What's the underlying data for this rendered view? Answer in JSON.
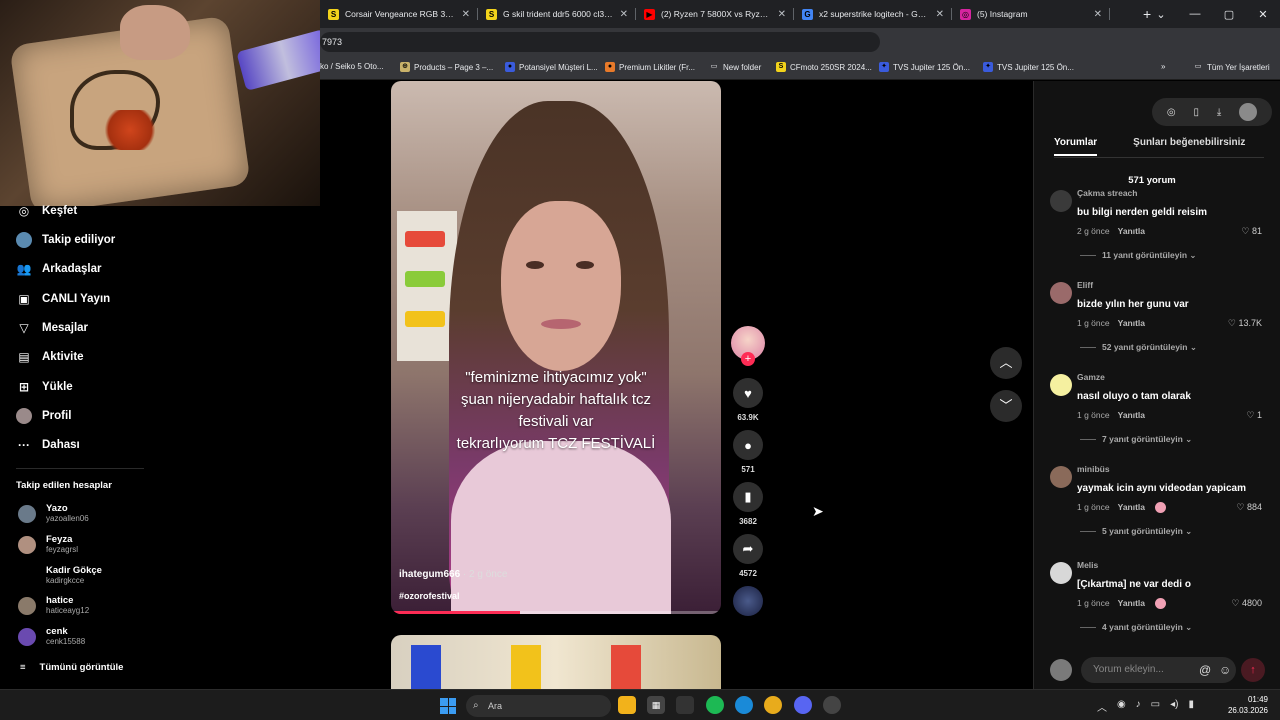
{
  "browser": {
    "tabs": [
      {
        "title": "Corsair Vengeance RGB 32 GB",
        "color": "#f2d31b",
        "letter": "S"
      },
      {
        "title": "G skil trident ddr5 6000 cl30 s",
        "color": "#f2d31b",
        "letter": "S"
      },
      {
        "title": "(2) Ryzen 7 5800X vs Ryzen 7 5",
        "color": "#ff0000",
        "letter": "▶"
      },
      {
        "title": "x2 superstrike logitech - Googl",
        "color": "#4285f4",
        "letter": "G"
      },
      {
        "title": "(5) Instagram",
        "color": "#d6249f",
        "letter": "◎"
      }
    ],
    "url_fragment": "7973",
    "bookmarks": [
      {
        "label": "ko / Seiko 5 Oto...",
        "color": "#000000",
        "letter": ""
      },
      {
        "label": "Products – Page 3 –...",
        "color": "#c9b26a",
        "letter": "⊕"
      },
      {
        "label": "Potansiyel Müşteri L...",
        "color": "#3a5bdc",
        "letter": "●"
      },
      {
        "label": "Premium Likitler (Fr...",
        "color": "#e87a2a",
        "letter": "●"
      },
      {
        "label": "New folder",
        "color": "#35363a",
        "letter": "▭"
      },
      {
        "label": "CFmoto 250SR 2024...",
        "color": "#f2d31b",
        "letter": "S"
      },
      {
        "label": "TVS Jupiter 125 Ön...",
        "color": "#3a5bdc",
        "letter": "✦"
      },
      {
        "label": "TVS Jupiter 125 Ön...",
        "color": "#3a5bdc",
        "letter": "✦"
      },
      {
        "label": "Tüm Yer İşaretleri",
        "color": "#35363a",
        "letter": "▭"
      }
    ]
  },
  "sidebar": {
    "nav": [
      {
        "label": "Keşfet",
        "icon": "compass-icon",
        "glyph": "◎"
      },
      {
        "label": "Takip ediliyor",
        "icon": "following-avatar-icon",
        "glyph": ""
      },
      {
        "label": "Arkadaşlar",
        "icon": "friends-icon",
        "glyph": "👥"
      },
      {
        "label": "CANLI Yayın",
        "icon": "live-icon",
        "glyph": "▣"
      },
      {
        "label": "Mesajlar",
        "icon": "messages-icon",
        "glyph": "▽"
      },
      {
        "label": "Aktivite",
        "icon": "activity-icon",
        "glyph": "▤"
      },
      {
        "label": "Yükle",
        "icon": "upload-icon",
        "glyph": "⊞"
      },
      {
        "label": "Profil",
        "icon": "profile-avatar-icon",
        "glyph": ""
      },
      {
        "label": "Dahası",
        "icon": "more-dots-icon",
        "glyph": "···"
      }
    ],
    "following_title": "Takip edilen hesaplar",
    "following": [
      {
        "name": "Yazo",
        "user": "yazoallen06"
      },
      {
        "name": "Feyza",
        "user": "feyzagrsl"
      },
      {
        "name": "Kadir Gökçe",
        "user": "kadirgkcce"
      },
      {
        "name": "hatice",
        "user": "haticeayg12"
      },
      {
        "name": "cenk",
        "user": "cenk15588"
      }
    ],
    "see_all": "Tümünü görüntüle"
  },
  "video": {
    "caption_lines": [
      "\"feminizme ihtiyacımız yok\"",
      "şuan nijeryadabir haftalık tcz",
      "festivali var",
      "tekrarlıyorum TCZ FESTİVALİ"
    ],
    "username": "ihategum666",
    "date": " · 2 g önce",
    "hashtag": "#ozorofestival",
    "progress": 0.39
  },
  "actions": {
    "likes": "63.9K",
    "comments": "571",
    "saves": "3682",
    "shares": "4572"
  },
  "comments_panel": {
    "tabs": [
      "Yorumlar",
      "Şunları beğenebilirsiniz"
    ],
    "count_title": "571 yorum",
    "comments": [
      {
        "name": "Çakma streach",
        "text": "bu bilgi nerden geldi reisim",
        "time": "2 g önce",
        "reply": "Yanıtla",
        "likes": "81",
        "more": "11 yanıt görüntüleyin",
        "avatar_color": "#3a3a3a",
        "liked_by_creator": false
      },
      {
        "name": "Eliff",
        "text": "bizde yılın her gunu var",
        "time": "1 g önce",
        "reply": "Yanıtla",
        "likes": "13.7K",
        "more": "52 yanıt görüntüleyin",
        "avatar_color": "#9a6a6a",
        "liked_by_creator": false
      },
      {
        "name": "Gamze",
        "text": "nasıl oluyo o tam olarak",
        "time": "1 g önce",
        "reply": "Yanıtla",
        "likes": "1",
        "more": "7 yanıt görüntüleyin",
        "avatar_color": "#f5f0a0",
        "liked_by_creator": false
      },
      {
        "name": "minibüs",
        "text": "yaymak icin aynı videodan yapicam",
        "time": "1 g önce",
        "reply": "Yanıtla",
        "likes": "884",
        "more": "5 yanıt görüntüleyin",
        "avatar_color": "#8a6a5a",
        "liked_by_creator": true
      },
      {
        "name": "Melis",
        "text": "[Çıkartma] ne var dedi o",
        "time": "1 g önce",
        "reply": "Yanıtla",
        "likes": "4800",
        "more": "4 yanıt görüntüleyin",
        "avatar_color": "#d8d8d8",
        "liked_by_creator": true
      }
    ],
    "input_placeholder": "Yorum ekleyin..."
  },
  "taskbar": {
    "search_label": "Ara",
    "time": "01:49",
    "date": "26.03.2026"
  }
}
